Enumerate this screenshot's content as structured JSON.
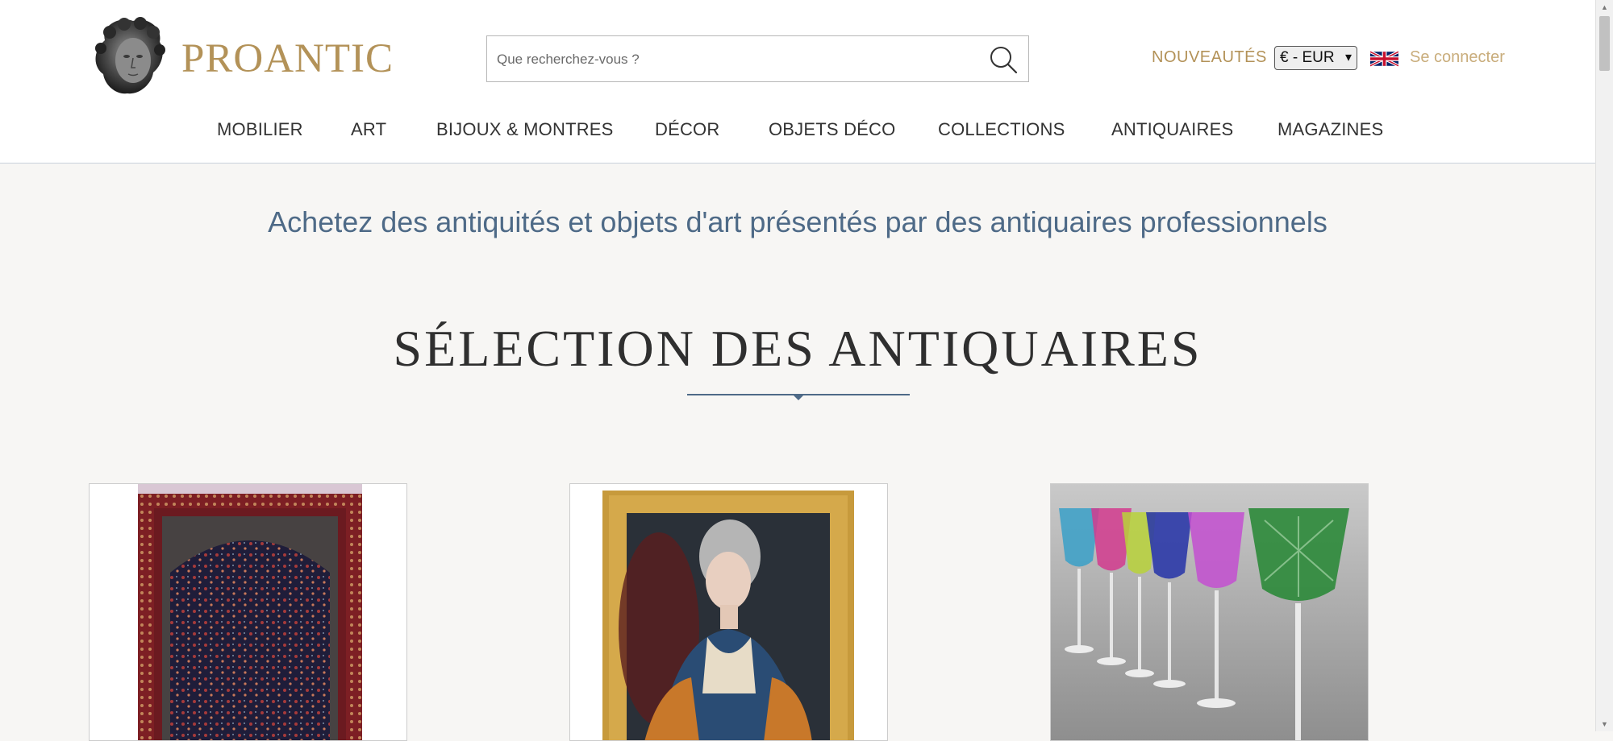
{
  "header": {
    "brand": "PROANTIC",
    "search": {
      "placeholder": "Que recherchez-vous ?"
    },
    "nouveautes": "NOUVEAUTÉS",
    "currency": "€ - EUR",
    "login": "Se connecter",
    "language_icon": "uk-flag-icon",
    "logo_icon": "sculpted-head-logo",
    "search_icon": "search-icon"
  },
  "nav": [
    {
      "label": "MOBILIER"
    },
    {
      "label": "ART"
    },
    {
      "label": "BIJOUX & MONTRES"
    },
    {
      "label": "DÉCOR"
    },
    {
      "label": "OBJETS DÉCO"
    },
    {
      "label": "COLLECTIONS"
    },
    {
      "label": "ANTIQUAIRES"
    },
    {
      "label": "MAGAZINES"
    }
  ],
  "main": {
    "tagline": "Achetez des antiquités et objets d'art présentés par des antiquaires professionnels",
    "section_title": "SÉLECTION DES ANTIQUAIRES",
    "cards": [
      {
        "image": "oriental-rug-image"
      },
      {
        "image": "framed-portrait-painting-image"
      },
      {
        "image": "colored-crystal-glasses-image"
      }
    ]
  },
  "colors": {
    "brand_gold": "#b39258",
    "tagline_blue": "#4e6a87",
    "background": "#f7f6f4"
  }
}
